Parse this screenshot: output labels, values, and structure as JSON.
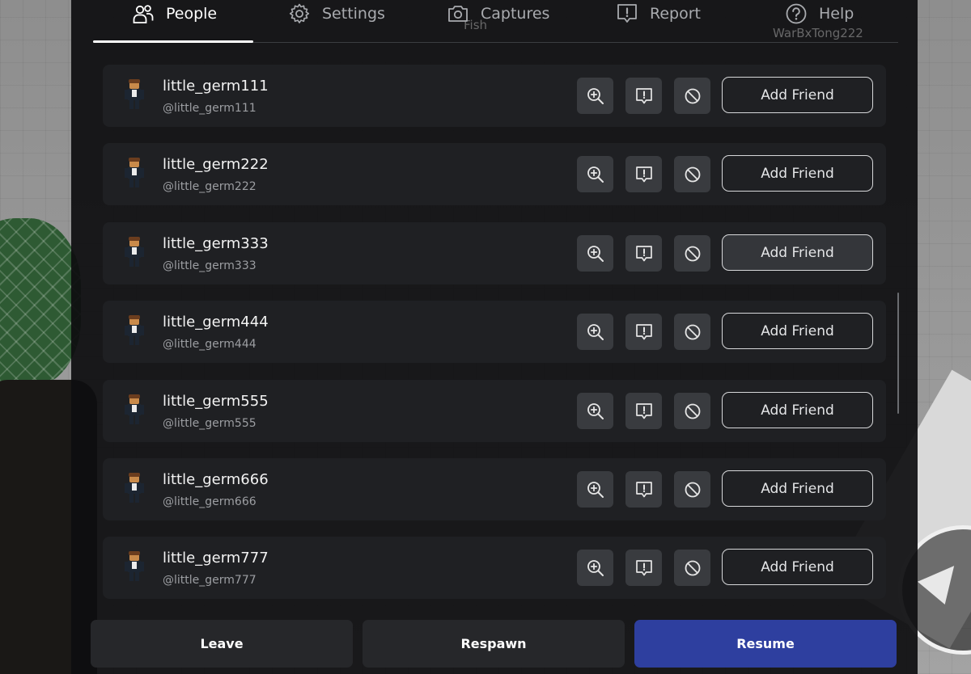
{
  "tabs": [
    {
      "label": "People",
      "icon": "people-icon",
      "active": true
    },
    {
      "label": "Settings",
      "icon": "gear-icon",
      "active": false
    },
    {
      "label": "Captures",
      "icon": "camera-icon",
      "active": false
    },
    {
      "label": "Report",
      "icon": "report-flag-icon",
      "active": false
    },
    {
      "label": "Help",
      "icon": "help-icon",
      "active": false
    }
  ],
  "background_text": {
    "fish": "Fish",
    "player_tag": "WarBxTong222"
  },
  "players": [
    {
      "name": "little_germ111",
      "handle": "@little_germ111",
      "friend_label": "Add Friend"
    },
    {
      "name": "little_germ222",
      "handle": "@little_germ222",
      "friend_label": "Add Friend"
    },
    {
      "name": "little_germ333",
      "handle": "@little_germ333",
      "friend_label": "Add Friend"
    },
    {
      "name": "little_germ444",
      "handle": "@little_germ444",
      "friend_label": "Add Friend"
    },
    {
      "name": "little_germ555",
      "handle": "@little_germ555",
      "friend_label": "Add Friend"
    },
    {
      "name": "little_germ666",
      "handle": "@little_germ666",
      "friend_label": "Add Friend"
    },
    {
      "name": "little_germ777",
      "handle": "@little_germ777",
      "friend_label": "Add Friend"
    }
  ],
  "row_actions": [
    "inspect-icon",
    "report-icon",
    "block-icon"
  ],
  "footer": {
    "leave": "Leave",
    "respawn": "Respawn",
    "resume": "Resume"
  },
  "colors": {
    "panel": "#0e0e10",
    "row": "#1f2023",
    "icon_button": "#393b3f",
    "resume": "#2e3f9f"
  }
}
